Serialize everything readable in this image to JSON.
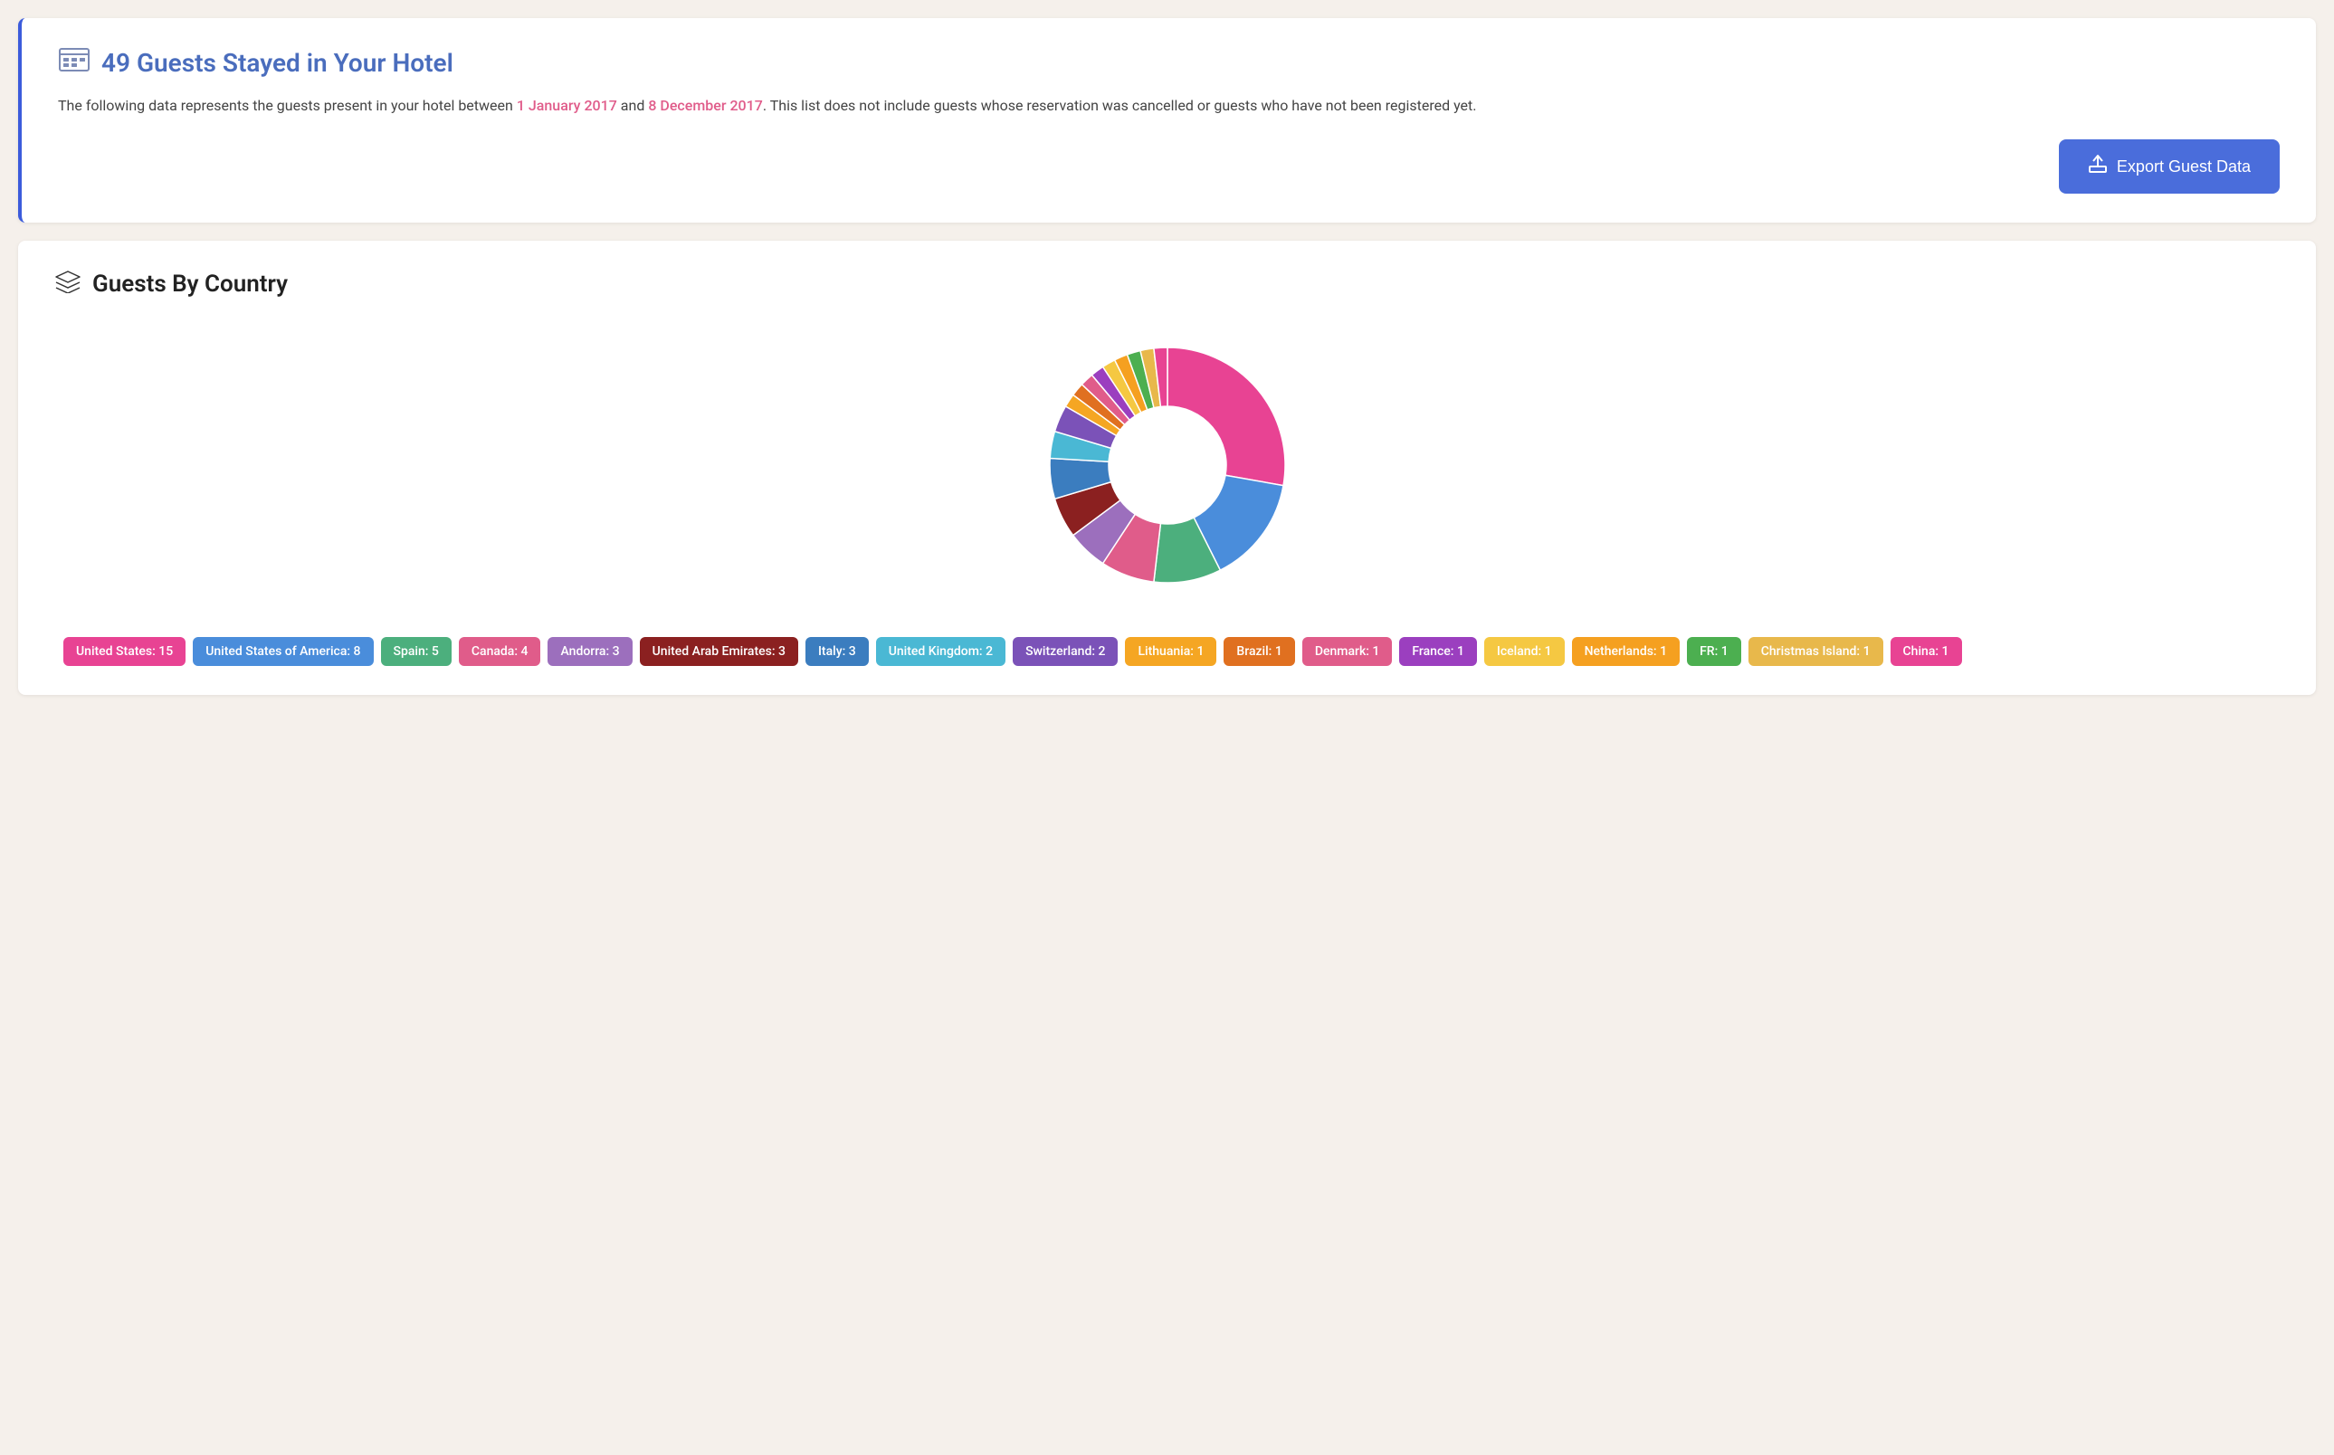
{
  "header": {
    "icon": "🗒",
    "title": "49 Guests Stayed in Your Hotel",
    "description_before": "The following data represents the guests present in your hotel between ",
    "date_start": "1 January 2017",
    "description_middle": " and ",
    "date_end": "8 December 2017",
    "description_after": ". This list does not include guests whose reservation was cancelled or guests who have not been registered yet.",
    "export_label": "Export Guest Data"
  },
  "guests_by_country": {
    "title": "Guests By Country",
    "countries": [
      {
        "name": "United States",
        "count": 15,
        "color": "#e84393"
      },
      {
        "name": "United States of America",
        "count": 8,
        "color": "#4a8ddb"
      },
      {
        "name": "Spain",
        "count": 5,
        "color": "#4caf7d"
      },
      {
        "name": "Canada",
        "count": 4,
        "color": "#e05c8a"
      },
      {
        "name": "Andorra",
        "count": 3,
        "color": "#9c6fbd"
      },
      {
        "name": "United Arab Emirates",
        "count": 3,
        "color": "#8b2020"
      },
      {
        "name": "Italy",
        "count": 3,
        "color": "#3b7dbf"
      },
      {
        "name": "United Kingdom",
        "count": 2,
        "color": "#4ab8d4"
      },
      {
        "name": "Switzerland",
        "count": 2,
        "color": "#7b52b8"
      },
      {
        "name": "Lithuania",
        "count": 1,
        "color": "#f5a623"
      },
      {
        "name": "Brazil",
        "count": 1,
        "color": "#e07020"
      },
      {
        "name": "Denmark",
        "count": 1,
        "color": "#e05c8a"
      },
      {
        "name": "France",
        "count": 1,
        "color": "#9b3fbf"
      },
      {
        "name": "Iceland",
        "count": 1,
        "color": "#f5c842"
      },
      {
        "name": "Netherlands",
        "count": 1,
        "color": "#f5a020"
      },
      {
        "name": "FR",
        "count": 1,
        "color": "#4caf50"
      },
      {
        "name": "Christmas Island",
        "count": 1,
        "color": "#e8b84b"
      },
      {
        "name": "China",
        "count": 1,
        "color": "#e84393"
      }
    ]
  }
}
